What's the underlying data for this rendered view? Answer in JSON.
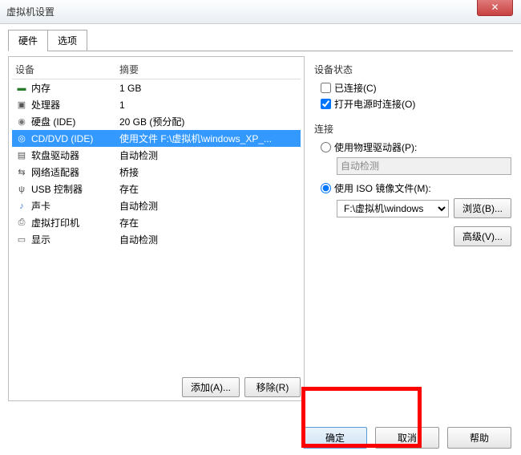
{
  "window": {
    "title": "虚拟机设置"
  },
  "tabs": {
    "hardware": "硬件",
    "options": "选项"
  },
  "list": {
    "header_device": "设备",
    "header_summary": "摘要",
    "rows": [
      {
        "device": "内存",
        "summary": "1 GB",
        "icon": "mem"
      },
      {
        "device": "处理器",
        "summary": "1",
        "icon": "cpu"
      },
      {
        "device": "硬盘 (IDE)",
        "summary": "20 GB (预分配)",
        "icon": "disk"
      },
      {
        "device": "CD/DVD (IDE)",
        "summary": "使用文件 F:\\虚拟机\\windows_XP_...",
        "icon": "cd",
        "selected": true
      },
      {
        "device": "软盘驱动器",
        "summary": "自动检测",
        "icon": "floppy"
      },
      {
        "device": "网络适配器",
        "summary": "桥接",
        "icon": "net"
      },
      {
        "device": "USB 控制器",
        "summary": "存在",
        "icon": "usb"
      },
      {
        "device": "声卡",
        "summary": "自动检测",
        "icon": "sound"
      },
      {
        "device": "虚拟打印机",
        "summary": "存在",
        "icon": "printer"
      },
      {
        "device": "显示",
        "summary": "自动检测",
        "icon": "display"
      }
    ]
  },
  "buttons": {
    "add": "添加(A)...",
    "remove": "移除(R)",
    "ok": "确定",
    "cancel": "取消",
    "help": "帮助",
    "browse": "浏览(B)...",
    "advanced": "高级(V)..."
  },
  "right": {
    "status_title": "设备状态",
    "connected": "已连接(C)",
    "connect_on_power": "打开电源时连接(O)",
    "connection_title": "连接",
    "use_physical": "使用物理驱动器(P):",
    "use_iso": "使用 ISO 镜像文件(M):",
    "physical_value": "自动检测",
    "iso_value": "F:\\虚拟机\\windows"
  }
}
